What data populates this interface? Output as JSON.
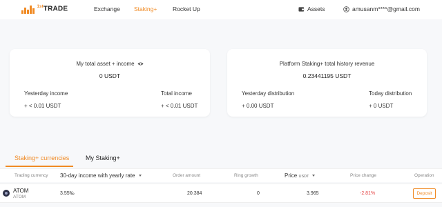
{
  "header": {
    "brand": "TRADE",
    "brand_prefix": "1st",
    "nav": [
      {
        "label": "Exchange",
        "active": false
      },
      {
        "label": "Staking+",
        "active": true
      },
      {
        "label": "Rocket Up",
        "active": false
      }
    ],
    "assets_label": "Assets",
    "assets_icon": "wallet-icon",
    "user_email": "amusanm****@gmail.com",
    "user_icon": "user-icon",
    "accent_color": "#f08a24"
  },
  "cards": {
    "my_asset": {
      "title": "My total asset + income",
      "title_icon": "eye-icon",
      "value": "0 USDT",
      "left_label": "Yesterday income",
      "left_value": "+ < 0.01 USDT",
      "right_label": "Total income",
      "right_value": "+ < 0.01 USDT"
    },
    "platform": {
      "title": "Platform Staking+ total history revenue",
      "value": "0.23441195 USDT",
      "left_label": "Yesterday distribution",
      "left_value": "+ 0.00 USDT",
      "right_label": "Today distribution",
      "right_value": "+ 0 USDT"
    }
  },
  "tabs": [
    {
      "label": "Staking+ currencies",
      "active": true
    },
    {
      "label": "My Staking+",
      "active": false
    }
  ],
  "table": {
    "headers": {
      "currency": "Trading currency",
      "income": "30-day income with yearly rate",
      "order_amount": "Order amount",
      "ring_growth": "Ring growth",
      "price": "Price",
      "price_unit": "USDT",
      "price_change": "Price change",
      "operation": "Operation"
    },
    "rows": [
      {
        "symbol": "ATOM",
        "name": "ATOM",
        "income": "3.55‰",
        "order_amount": "20.384",
        "ring_growth": "0",
        "price": "3.965",
        "price_change": "-2.81%",
        "action": "Deposit"
      }
    ]
  }
}
